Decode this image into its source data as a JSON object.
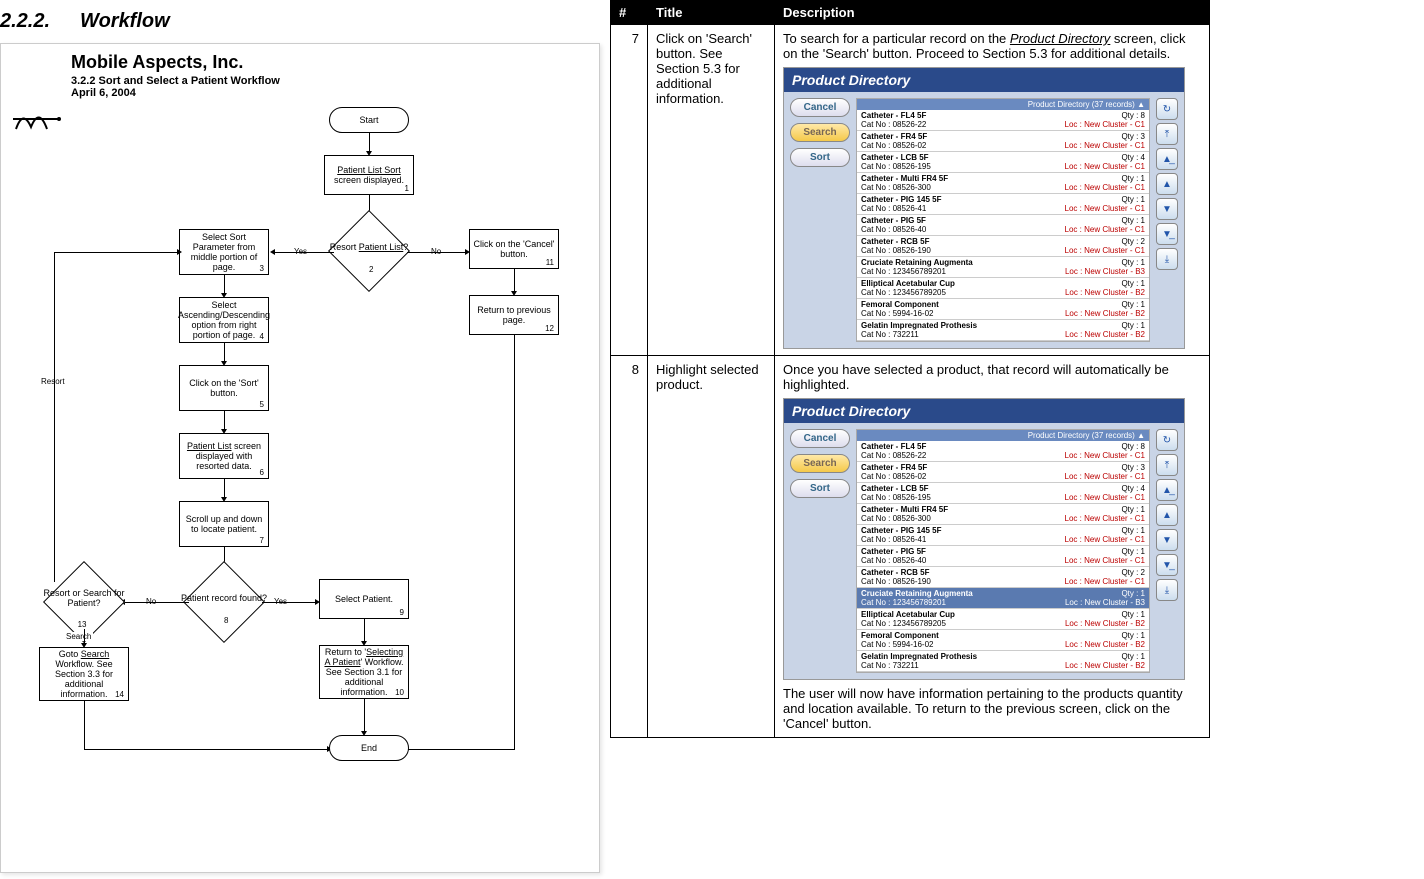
{
  "section": {
    "number": "2.2.2.",
    "title": "Workflow"
  },
  "diagram": {
    "company": "Mobile Aspects, Inc.",
    "subtitle": "3.2.2 Sort and Select a Patient Workflow",
    "date": "April 6, 2004",
    "start": "Start",
    "end": "End",
    "box1": {
      "t": "Patient List Sort",
      "b": "screen displayed.",
      "n": "1"
    },
    "dec2": {
      "t": "Resort Patient List?",
      "n": "2"
    },
    "box3": {
      "t": "Select Sort Parameter from middle portion of page.",
      "n": "3"
    },
    "box4": {
      "t": "Select Ascending/Descending option from right portion of page.",
      "n": "4"
    },
    "box5": {
      "t": "Click on the 'Sort' button.",
      "n": "5"
    },
    "box6": {
      "t": "Patient List screen displayed with resorted data.",
      "n": "6"
    },
    "box7": {
      "t": "Scroll up and down to locate patient.",
      "n": "7"
    },
    "dec8": {
      "t": "Patient record found?",
      "n": "8"
    },
    "box9": {
      "t": "Select Patient.",
      "n": "9"
    },
    "box10": {
      "t": "Return to 'Selecting A Patient' Workflow.  See Section 3.1 for additional information.",
      "n": "10"
    },
    "box11": {
      "t": "Click on the 'Cancel' button.",
      "n": "11"
    },
    "box12": {
      "t": "Return to previous page.",
      "n": "12"
    },
    "dec13": {
      "t": "Resort or Search for Patient?",
      "n": "13"
    },
    "box14": {
      "t": "Goto Search Workflow.  See Section 3.3 for additional information.",
      "n": "14"
    },
    "lblYes": "Yes",
    "lblNo": "No",
    "lblResort": "Resort",
    "lblSearch": "Search"
  },
  "table": {
    "headers": {
      "num": "#",
      "title": "Title",
      "desc": "Description"
    },
    "rows": [
      {
        "num": "7",
        "title": "Click on 'Search' button.  See Section 5.3 for additional information.",
        "desc_top": "To search for a particular record on the Product Directory screen, click on the 'Search' button.  Proceed to Section 5.3 for additional details.",
        "desc_bottom": ""
      },
      {
        "num": "8",
        "title": "Highlight selected product.",
        "desc_top": "Once you have selected a product, that record will automatically be highlighted.",
        "desc_bottom": "The user will now have information pertaining to the products quantity and location available.  To return to the previous screen, click on the 'Cancel' button."
      }
    ]
  },
  "thumb": {
    "header": "Product Directory",
    "count": "Product Directory (37 records)",
    "btn_cancel": "Cancel",
    "btn_search": "Search",
    "btn_sort": "Sort",
    "items": [
      {
        "name": "Catheter - FL4 5F",
        "cat": "Cat No : 08526-22",
        "qty": "Qty : 8",
        "loc": "Loc : New Cluster - C1"
      },
      {
        "name": "Catheter - FR4 5F",
        "cat": "Cat No : 08526-02",
        "qty": "Qty : 3",
        "loc": "Loc : New Cluster - C1"
      },
      {
        "name": "Catheter - LCB 5F",
        "cat": "Cat No : 08526-195",
        "qty": "Qty : 4",
        "loc": "Loc : New Cluster - C1"
      },
      {
        "name": "Catheter - Multi FR4 5F",
        "cat": "Cat No : 08526-300",
        "qty": "Qty : 1",
        "loc": "Loc : New Cluster - C1"
      },
      {
        "name": "Catheter - PIG 145 5F",
        "cat": "Cat No : 08526-41",
        "qty": "Qty : 1",
        "loc": "Loc : New Cluster - C1"
      },
      {
        "name": "Catheter - PIG 5F",
        "cat": "Cat No : 08526-40",
        "qty": "Qty : 1",
        "loc": "Loc : New Cluster - C1"
      },
      {
        "name": "Catheter - RCB 5F",
        "cat": "Cat No : 08526-190",
        "qty": "Qty : 2",
        "loc": "Loc : New Cluster - C1"
      },
      {
        "name": "Cruciate Retaining Augmenta",
        "cat": "Cat No : 123456789201",
        "qty": "Qty : 1",
        "loc": "Loc : New Cluster - B3"
      },
      {
        "name": "Elliptical Acetabular Cup",
        "cat": "Cat No : 123456789205",
        "qty": "Qty : 1",
        "loc": "Loc : New Cluster - B2"
      },
      {
        "name": "Femoral Component",
        "cat": "Cat No : 5994-16-02",
        "qty": "Qty : 1",
        "loc": "Loc : New Cluster - B2"
      },
      {
        "name": "Gelatin Impregnated Prothesis",
        "cat": "Cat No : 732211",
        "qty": "Qty : 1",
        "loc": "Loc : New Cluster - B2"
      }
    ],
    "selected_index": 7
  }
}
